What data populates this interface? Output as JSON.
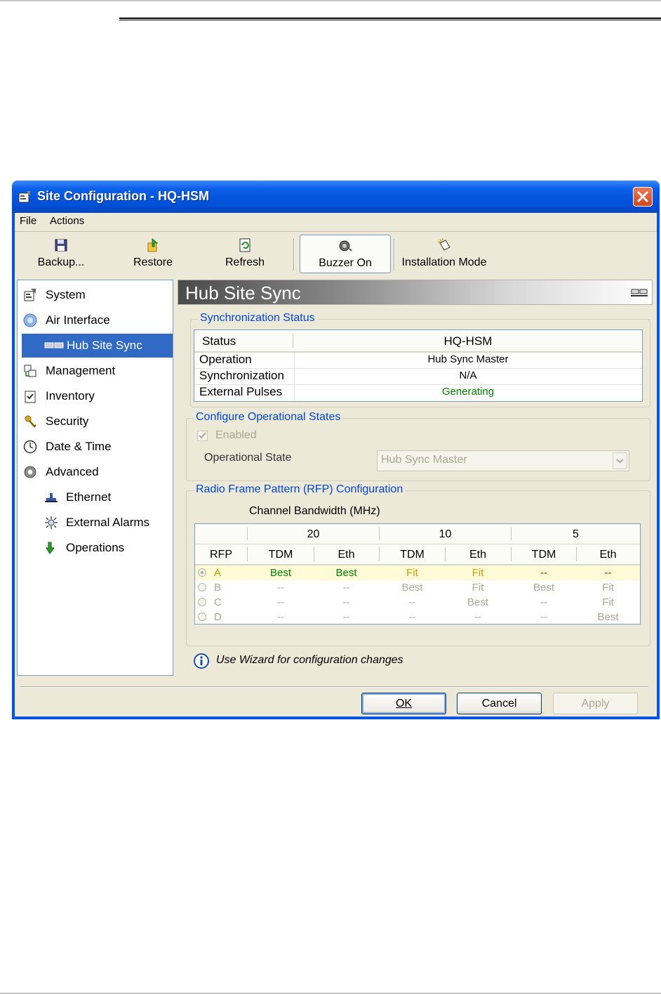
{
  "window": {
    "title": "Site Configuration - HQ-HSM"
  },
  "menu": {
    "items": [
      "File",
      "Actions"
    ]
  },
  "toolbar": {
    "backup": "Backup...",
    "restore": "Restore",
    "refresh": "Refresh",
    "buzzer": "Buzzer On",
    "installation": "Installation Mode"
  },
  "nav": {
    "items": [
      {
        "label": "System",
        "icon": "system-icon"
      },
      {
        "label": "Air Interface",
        "icon": "air-interface-icon"
      },
      {
        "label": "Hub Site Sync",
        "icon": "hub-site-sync-icon",
        "selected": true
      },
      {
        "label": "Management",
        "icon": "management-icon"
      },
      {
        "label": "Inventory",
        "icon": "inventory-icon"
      },
      {
        "label": "Security",
        "icon": "security-icon"
      },
      {
        "label": "Date & Time",
        "icon": "clock-icon"
      },
      {
        "label": "Advanced",
        "icon": "gear-icon"
      },
      {
        "label": "Ethernet",
        "icon": "ethernet-icon"
      },
      {
        "label": "External Alarms",
        "icon": "alarm-icon"
      },
      {
        "label": "Operations",
        "icon": "arrow-down-icon"
      }
    ]
  },
  "panel": {
    "title": "Hub Site Sync",
    "sync_status": {
      "title": "Synchronization Status",
      "header": [
        "Status",
        "HQ-HSM"
      ],
      "rows": [
        {
          "label": "Operation",
          "value": "Hub Sync Master"
        },
        {
          "label": "Synchronization",
          "value": "N/A"
        },
        {
          "label": "External Pulses",
          "value": "Generating"
        }
      ]
    },
    "op_states": {
      "title": "Configure Operational States",
      "enabled_label": "Enabled",
      "enabled_checked": true,
      "state_label": "Operational State",
      "state_value": "Hub Sync Master"
    },
    "rfp": {
      "title": "Radio Frame Pattern (RFP) Configuration",
      "bandwidth_label": "Channel Bandwidth (MHz)",
      "bandwidths": [
        "20",
        "10",
        "5"
      ],
      "columns": [
        "RFP",
        "TDM",
        "Eth",
        "TDM",
        "Eth",
        "TDM",
        "Eth"
      ],
      "rows": [
        {
          "rfp": "A",
          "selected": true,
          "cells": [
            "Best",
            "Best",
            "Fit",
            "Fit",
            "--",
            "--"
          ]
        },
        {
          "rfp": "B",
          "selected": false,
          "cells": [
            "--",
            "--",
            "Best",
            "Fit",
            "Best",
            "Fit"
          ]
        },
        {
          "rfp": "C",
          "selected": false,
          "cells": [
            "--",
            "--",
            "--",
            "Best",
            "--",
            "Fit"
          ]
        },
        {
          "rfp": "D",
          "selected": false,
          "cells": [
            "--",
            "--",
            "--",
            "--",
            "--",
            "Best"
          ]
        }
      ],
      "status_colors": {
        "Best": "#008000",
        "Fit": "#c8a000",
        "--": "#e00000"
      }
    },
    "hint": "Use Wizard for configuration changes"
  },
  "buttons": {
    "ok": "OK",
    "cancel": "Cancel",
    "apply": "Apply"
  },
  "colors": {
    "selection": "#316ac5",
    "group_title": "#0046d5",
    "titlebar": "#0054e3"
  }
}
